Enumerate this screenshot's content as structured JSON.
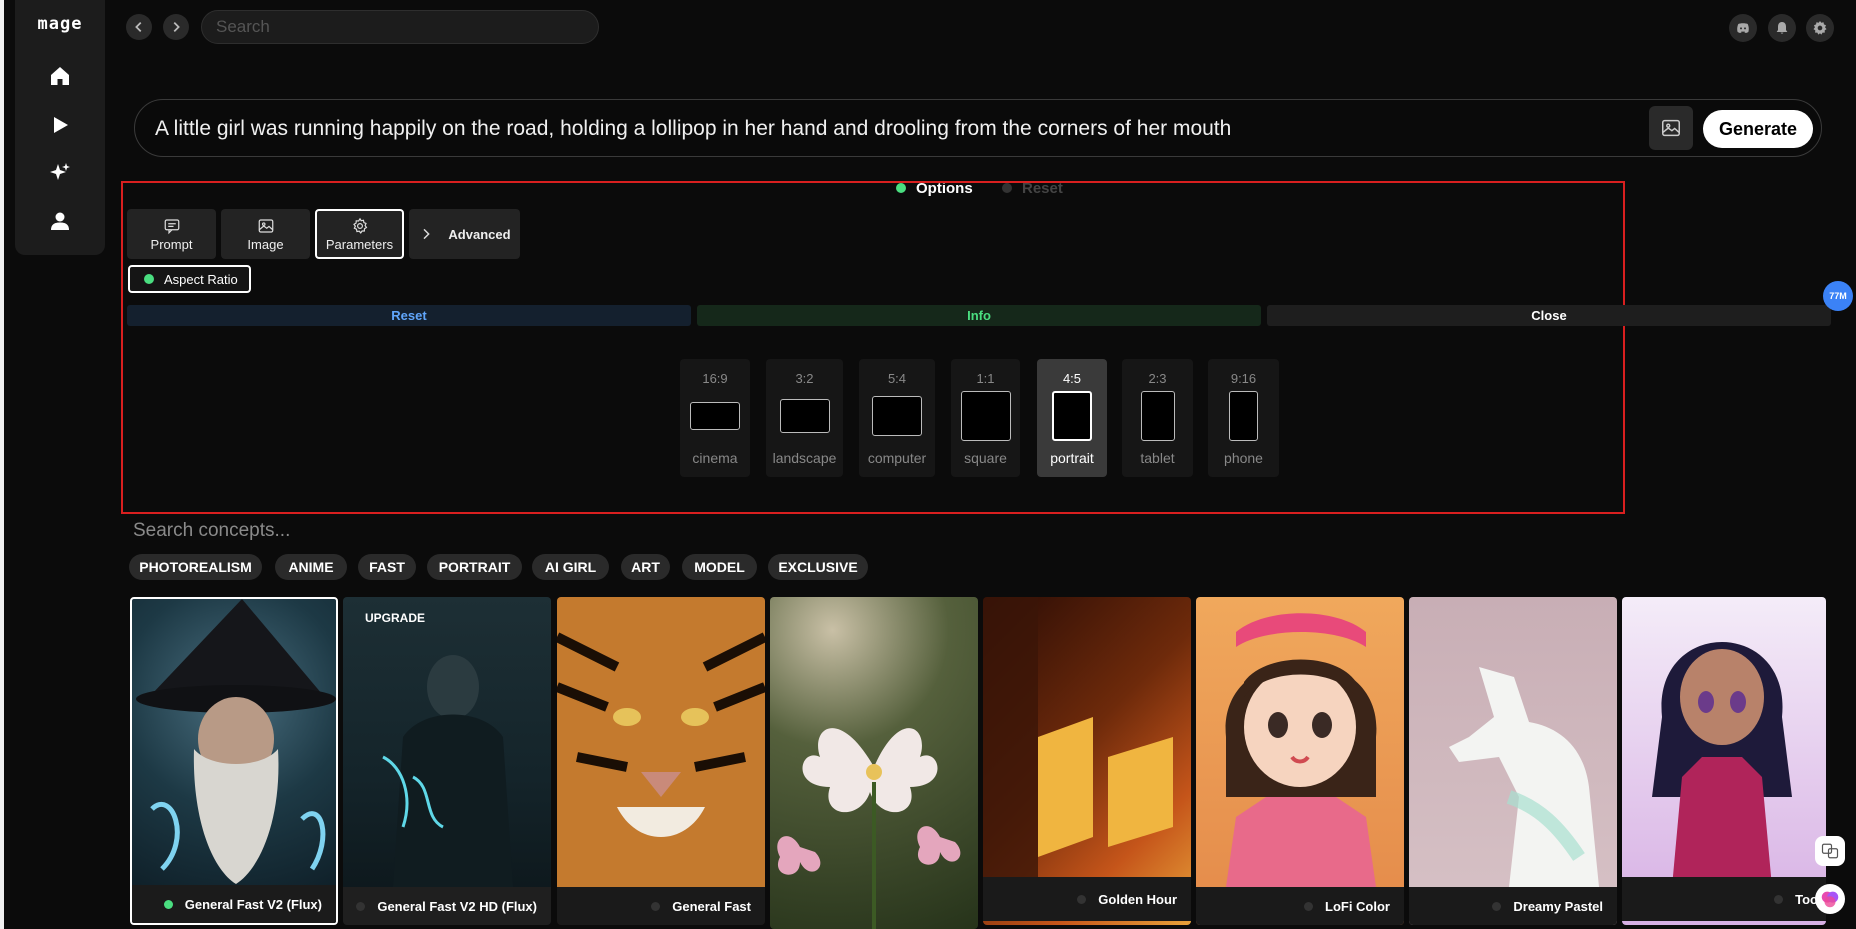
{
  "app": {
    "logo": "mage"
  },
  "sidebar": {
    "items": [
      {
        "name": "home",
        "icon": "home-icon"
      },
      {
        "name": "play",
        "icon": "play-icon"
      },
      {
        "name": "create",
        "icon": "sparkles-icon"
      },
      {
        "name": "profile",
        "icon": "user-icon"
      }
    ]
  },
  "topbar": {
    "search_placeholder": "Search",
    "icons": [
      "discord-icon",
      "bell-icon",
      "gear-icon"
    ]
  },
  "prompt": {
    "text": "A little girl was running happily on the road, holding a lollipop in her hand and drooling from the corners of her mouth",
    "generate_label": "Generate"
  },
  "options": {
    "options_label": "Options",
    "reset_label": "Reset",
    "tabs": [
      {
        "label": "Prompt",
        "icon": "chat-icon"
      },
      {
        "label": "Image",
        "icon": "image-icon"
      },
      {
        "label": "Parameters",
        "icon": "settings-icon",
        "active": true
      },
      {
        "label": "Advanced",
        "icon": "chevron-right-icon"
      }
    ],
    "aspect_chip": "Aspect Ratio",
    "actions": {
      "reset": "Reset",
      "info": "Info",
      "close": "Close"
    },
    "ratios": [
      {
        "ratio": "16:9",
        "name": "cinema"
      },
      {
        "ratio": "3:2",
        "name": "landscape"
      },
      {
        "ratio": "5:4",
        "name": "computer"
      },
      {
        "ratio": "1:1",
        "name": "square"
      },
      {
        "ratio": "4:5",
        "name": "portrait",
        "selected": true
      },
      {
        "ratio": "2:3",
        "name": "tablet"
      },
      {
        "ratio": "9:16",
        "name": "phone"
      }
    ]
  },
  "concepts": {
    "search_placeholder": "Search concepts...",
    "categories": [
      "PHOTOREALISM",
      "ANIME",
      "FAST",
      "PORTRAIT",
      "AI GIRL",
      "ART",
      "MODEL",
      "EXCLUSIVE"
    ]
  },
  "models": [
    {
      "name": "General Fast V2 (Flux)",
      "selected": true,
      "status": "green"
    },
    {
      "name": "General Fast V2 HD (Flux)",
      "badge": "UPGRADE"
    },
    {
      "name": "General Fast"
    },
    {
      "name": ""
    },
    {
      "name": "Golden Hour"
    },
    {
      "name": "LoFi Color"
    },
    {
      "name": "Dreamy Pastel"
    },
    {
      "name": "Too"
    }
  ],
  "floating": {
    "badge": "77M"
  },
  "colors": {
    "accent_green": "#4ade80",
    "reset_blue": "#60a5fa",
    "highlight_red": "#d91f1f"
  }
}
